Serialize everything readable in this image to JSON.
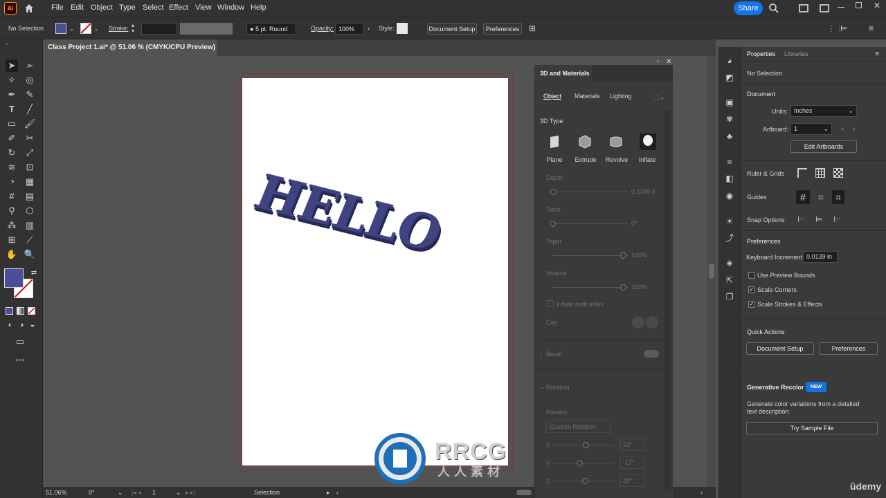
{
  "app": {
    "logo": "Ai"
  },
  "menu": [
    "File",
    "Edit",
    "Object",
    "Type",
    "Select",
    "Effect",
    "View",
    "Window",
    "Help"
  ],
  "share_label": "Share",
  "control": {
    "selection": "No Selection",
    "stroke_label": "Stroke:",
    "brush": "5 pt. Round",
    "opacity_label": "Opacity:",
    "opacity_value": "100%",
    "style_label": "Style:",
    "document_setup": "Document Setup",
    "preferences": "Preferences"
  },
  "document": {
    "tab": "Class Project 1.ai* @ 51.06 % (CMYK/CPU Preview)",
    "text": "HELLO"
  },
  "status": {
    "zoom": "51.06%",
    "rotation": "0°",
    "artboard": "1",
    "tool": "Selection"
  },
  "panel3d": {
    "title": "3D and Materials",
    "tabs": [
      "Object",
      "Materials",
      "Lighting"
    ],
    "section": "3D Type",
    "types": [
      "Plane",
      "Extrude",
      "Revolve",
      "Inflate"
    ],
    "depth_label": "Depth",
    "depth_value": "0.1389 ir",
    "twist_label": "Twist",
    "twist_value": "0°",
    "taper_label": "Taper",
    "taper_value": "100%",
    "volume_label": "Volume",
    "volume_value": "100%",
    "inflate_both": "Inflate both sides",
    "cap_label": "Cap",
    "bevel_label": "Bevel",
    "rotation_label": "Rotation",
    "presets_label": "Presets",
    "presets_value": "Custom Rotation",
    "x_label": "X",
    "x_value": "23°",
    "y_label": "Y",
    "y_value": "-17°",
    "z_label": "Z",
    "z_value": "20°"
  },
  "properties": {
    "tabs": [
      "Properties",
      "Libraries"
    ],
    "selection": "No Selection",
    "document_label": "Document",
    "units_label": "Units:",
    "units_value": "Inches",
    "artboard_label": "Artboard:",
    "artboard_value": "1",
    "edit_artboards": "Edit Artboards",
    "ruler_grids": "Ruler & Grids",
    "guides": "Guides",
    "snap_options": "Snap Options",
    "preferences": "Preferences",
    "keyboard_increment_label": "Keyboard Increment:",
    "keyboard_increment_value": "0.0139 in",
    "use_preview_bounds": "Use Preview Bounds",
    "scale_corners": "Scale Corners",
    "scale_strokes": "Scale Strokes & Effects",
    "quick_actions": "Quick Actions",
    "document_setup": "Document Setup",
    "preferences_btn": "Preferences",
    "gen_recolor": "Generative Recolor",
    "new_badge": "NEW",
    "gen_desc": "Generate color variations from a detailed text description",
    "try_sample": "Try Sample File"
  },
  "watermark": {
    "brand": "RRCG",
    "sub": "人人素材"
  },
  "udemy": "ûdemy",
  "colors": {
    "fill": "#4a4f97",
    "accent": "#1473e6",
    "text3d": "#3f4382"
  }
}
